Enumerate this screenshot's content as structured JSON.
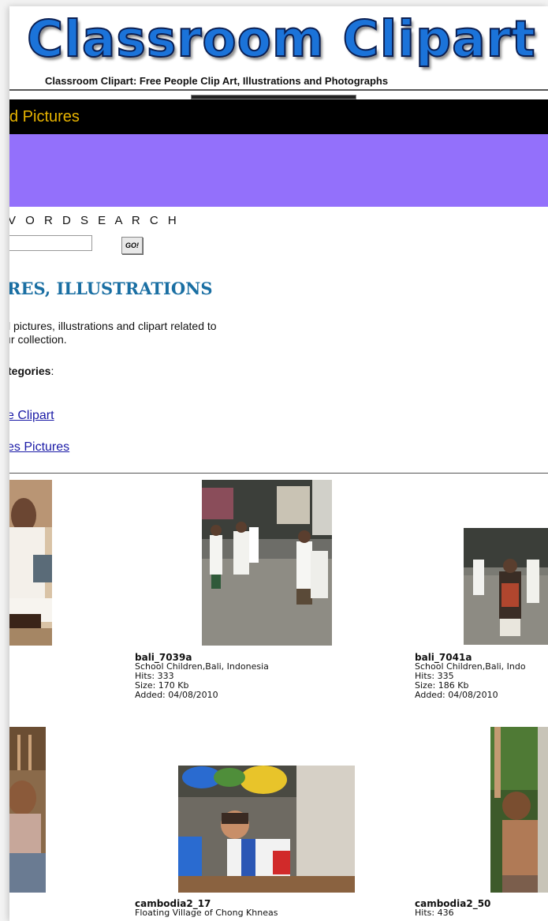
{
  "header": {
    "logo_text": "Classroom Clipart",
    "tagline": "Classroom Clipart: Free People Clip Art, Illustrations and Photographs"
  },
  "nav": {
    "title": "d Pictures"
  },
  "search": {
    "label": "V O R D S E A R C H",
    "value": "",
    "go_label": "GO!"
  },
  "main": {
    "heading": "RES, ILLUSTRATIONS",
    "intro_line1": "l pictures, illustrations and clipart related to",
    "intro_line2": "ır collection.",
    "categories_label": "tegories",
    "categories_colon": ":",
    "links": [
      "e Clipart",
      "es Pictures"
    ]
  },
  "gallery": [
    {
      "name": "bali_7039a",
      "desc": "School Children,Bali, Indonesia",
      "hits": "Hits: 333",
      "size": "Size: 170 Kb",
      "added": "Added: 04/08/2010"
    },
    {
      "name": "bali_7041a",
      "desc": "School Children,Bali, Indo",
      "hits": "Hits: 335",
      "size": "Size: 186 Kb",
      "added": "Added: 04/08/2010"
    },
    {
      "name": "cambodia2_17",
      "desc": "Floating Village of Chong Khneas",
      "hits": "",
      "size": "",
      "added": ""
    },
    {
      "name": "cambodia2_50",
      "desc": "Hits: 436",
      "hits": "",
      "size": "",
      "added": ""
    }
  ],
  "colors": {
    "brand_blue": "#1b73d9",
    "purple_bar": "#9370fb",
    "nav_text": "#e8b400",
    "heading": "#1a6fa3",
    "link": "#1a1aa6"
  }
}
